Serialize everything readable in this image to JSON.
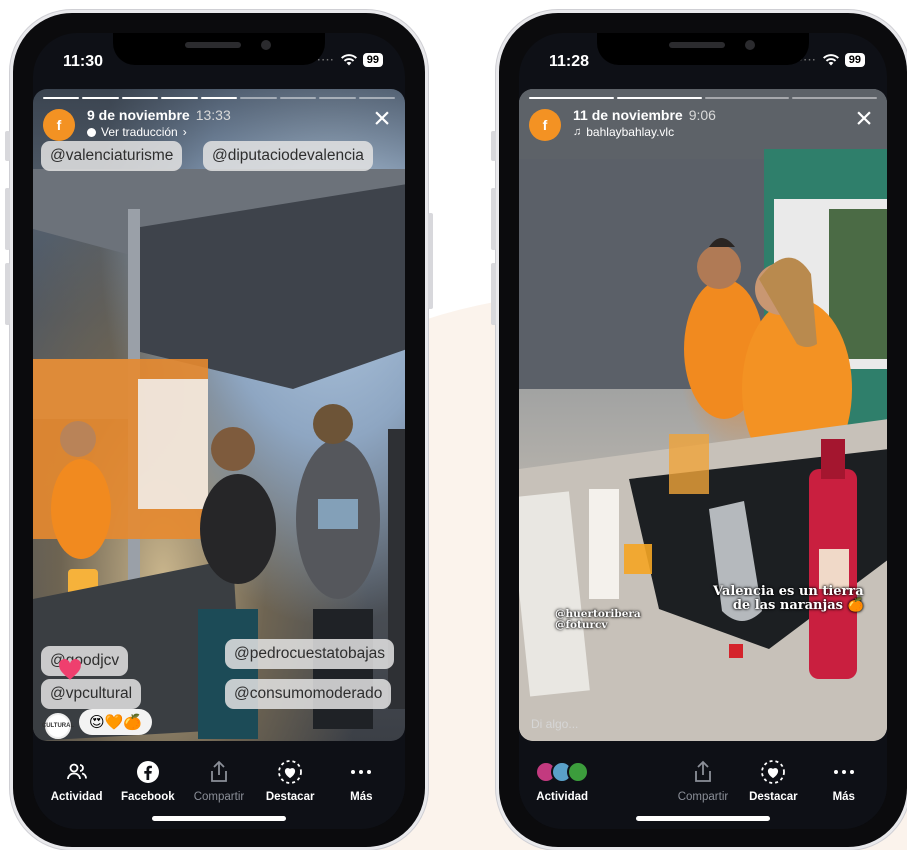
{
  "left_phone": {
    "status_time": "11:30",
    "battery": "99",
    "story": {
      "avatar_letter": "f",
      "date": "9 de noviembre",
      "time": "13:33",
      "subtitle": "Ver traducción",
      "subtitle_chevron": "›",
      "close_symbol": "×",
      "tags": {
        "tag1": "@valenciaturisme",
        "tag2": "@diputaciodevalencia",
        "tag3": "@goodjcv",
        "tag4": "@pedrocuestatobajas",
        "tag5": "@vpcultural",
        "tag6": "@consumomoderado"
      },
      "reaction_avatar_text": "CULTURAL",
      "reaction_emojis": "😍🧡🍊"
    },
    "actions": [
      {
        "label": "Actividad",
        "icon": "people-icon"
      },
      {
        "label": "Facebook",
        "icon": "facebook-icon"
      },
      {
        "label": "Compartir",
        "icon": "share-icon"
      },
      {
        "label": "Destacar",
        "icon": "highlight-icon"
      },
      {
        "label": "Más",
        "icon": "more-icon"
      }
    ]
  },
  "right_phone": {
    "status_time": "11:28",
    "battery": "99",
    "story": {
      "avatar_letter": "f",
      "date": "11 de noviembre",
      "time": "9:06",
      "music_user": "bahlaybahlay.vlc",
      "close_symbol": "×",
      "overlay_line1": "Valencia es un tierra",
      "overlay_line2": "de las naranjas 🍊",
      "overlay_tag1": "@huertoribera",
      "overlay_tag2": "@foturcv",
      "placeholder": "Di algo..."
    },
    "actions": [
      {
        "label": "Actividad",
        "icon": "viewers-avatars"
      },
      {
        "label": "Compartir",
        "icon": "share-icon"
      },
      {
        "label": "Destacar",
        "icon": "highlight-icon"
      },
      {
        "label": "Más",
        "icon": "more-icon"
      }
    ]
  },
  "colors": {
    "brand_orange": "#f39223",
    "bar_bg": "#0e1016",
    "tag_bg": "#e2e2e2"
  }
}
